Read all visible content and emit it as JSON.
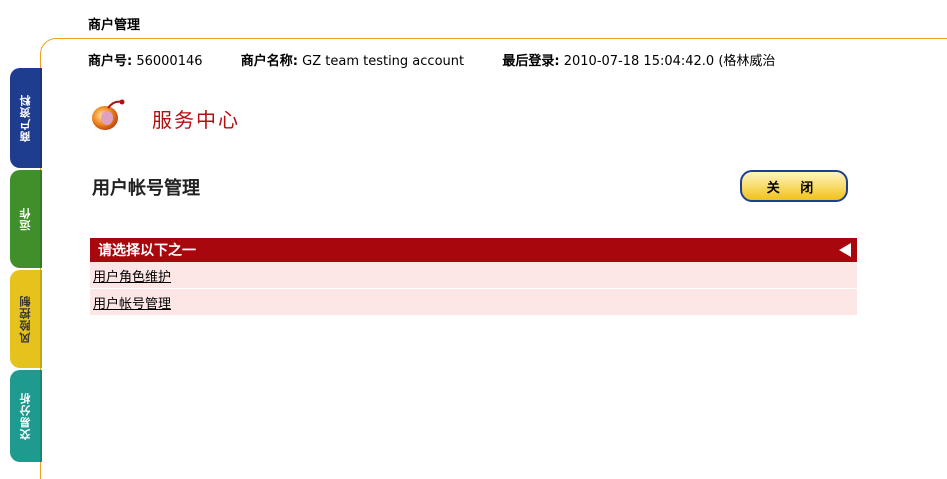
{
  "header": {
    "title": "商户管理"
  },
  "merchant_info": {
    "id_label": "商户号:",
    "id_value": "56000146",
    "name_label": "商户名称:",
    "name_value": "GZ team testing account",
    "login_label": "最后登录:",
    "login_value": "2010-07-18 15:04:42.0 (格林威治"
  },
  "side_tabs": [
    {
      "label": "商户资料",
      "color": "#1f3d8f"
    },
    {
      "label": "运作",
      "color": "#3f8f2a"
    },
    {
      "label": "风险控制",
      "color": "#e5c21c"
    },
    {
      "label": "交易分析",
      "color": "#1f9a8f"
    }
  ],
  "service": {
    "title": "服务中心"
  },
  "page": {
    "title": "用户帐号管理",
    "close_label": "关 闭"
  },
  "menu": {
    "header": "请选择以下之一",
    "items": [
      {
        "label": "用户角色维护"
      },
      {
        "label": "用户帐号管理"
      }
    ]
  },
  "colors": {
    "accent_red": "#a8070d",
    "row_pink": "#fde6e6",
    "frame_orange": "#f0a020"
  }
}
